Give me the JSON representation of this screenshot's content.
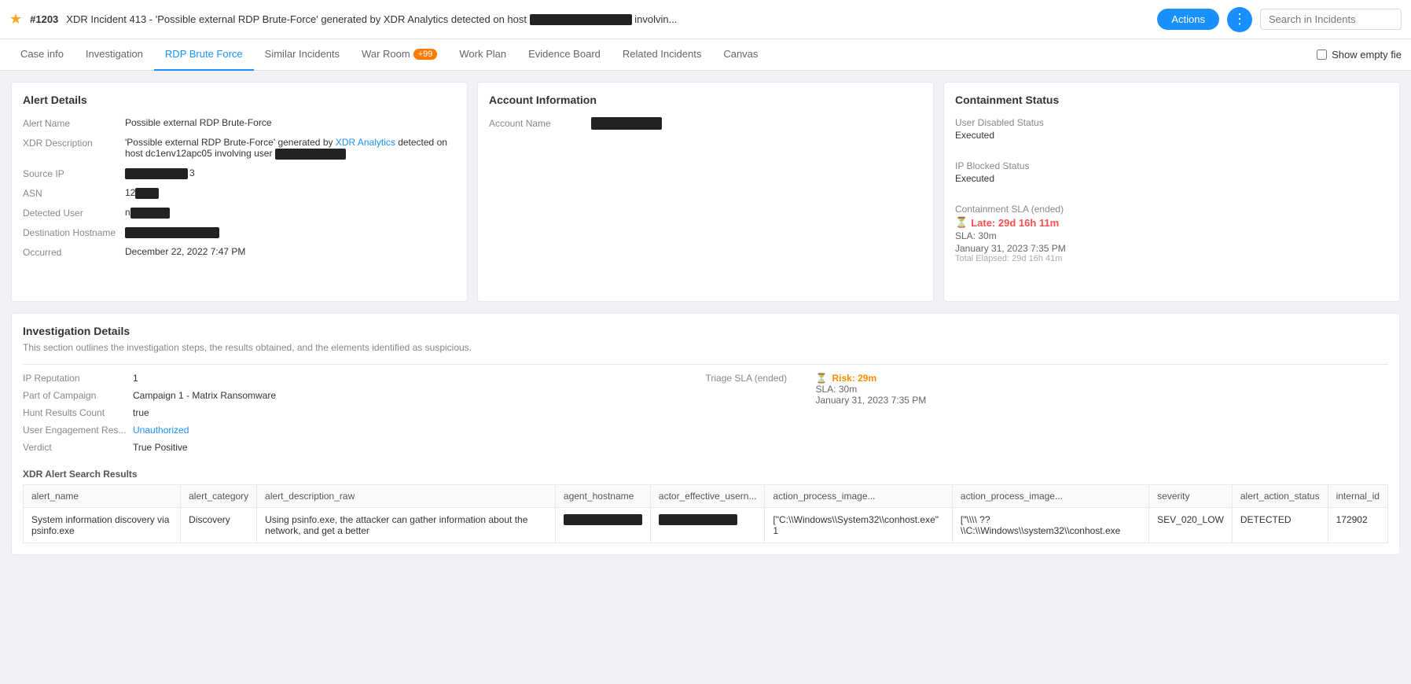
{
  "header": {
    "star": "★",
    "id": "#1203",
    "title": " XDR Incident 413 - 'Possible external RDP Brute-Force' generated by XDR Analytics detected on host ",
    "title_redacted": true,
    "title_suffix": " involvin...",
    "actions_label": "Actions",
    "more_icon": "⋮",
    "search_placeholder": "Search in Incidents"
  },
  "tabs": {
    "items": [
      {
        "id": "case-info",
        "label": "Case info",
        "active": false
      },
      {
        "id": "investigation",
        "label": "Investigation",
        "active": false
      },
      {
        "id": "rdp-brute-force",
        "label": "RDP Brute Force",
        "active": true
      },
      {
        "id": "similar-incidents",
        "label": "Similar Incidents",
        "active": false
      },
      {
        "id": "war-room",
        "label": "War Room",
        "active": false,
        "badge": "+99"
      },
      {
        "id": "work-plan",
        "label": "Work Plan",
        "active": false
      },
      {
        "id": "evidence-board",
        "label": "Evidence Board",
        "active": false
      },
      {
        "id": "related-incidents",
        "label": "Related Incidents",
        "active": false
      },
      {
        "id": "canvas",
        "label": "Canvas",
        "active": false
      }
    ],
    "show_empty_label": "Show empty fie"
  },
  "alert_details": {
    "title": "Alert Details",
    "fields": [
      {
        "label": "Alert Name",
        "value": "Possible external RDP Brute-Force",
        "redacted": false
      },
      {
        "label": "XDR Description",
        "value": "'Possible external RDP Brute-Force' generated by XDR Analytics detected on host dc1env12apc05 involving user",
        "redacted_suffix": true
      },
      {
        "label": "Source IP",
        "value": "",
        "redacted": true,
        "suffix": "3"
      },
      {
        "label": "ASN",
        "value": "12",
        "redacted": true
      },
      {
        "label": "Detected User",
        "value": "n",
        "redacted": true
      },
      {
        "label": "Destination Hostname",
        "value": "",
        "redacted": true
      },
      {
        "label": "Occurred",
        "value": "December 22, 2022 7:47 PM",
        "redacted": false
      }
    ]
  },
  "account_info": {
    "title": "Account Information",
    "fields": [
      {
        "label": "Account Name",
        "value": "",
        "redacted": true
      }
    ]
  },
  "containment_status": {
    "title": "Containment Status",
    "user_disabled_label": "User Disabled Status",
    "user_disabled_value": "Executed",
    "ip_blocked_label": "IP Blocked Status",
    "ip_blocked_value": "Executed",
    "sla_label": "Containment SLA (ended)",
    "sla_late": "Late: 29d 16h 11m",
    "sla_detail": "SLA: 30m",
    "sla_date": "January 31, 2023 7:35 PM",
    "sla_elapsed": "Total Elapsed: 29d 16h 41m"
  },
  "investigation_details": {
    "title": "Investigation Details",
    "description": "This section outlines the investigation steps, the results obtained, and the elements identified as suspicious.",
    "left_fields": [
      {
        "label": "IP Reputation",
        "value": "1"
      },
      {
        "label": "Part of Campaign",
        "value": "Campaign 1 - Matrix Ransomware"
      },
      {
        "label": "Hunt Results Count",
        "value": "true"
      },
      {
        "label": "User Engagement Res...",
        "value": "Unauthorized",
        "highlight": "link"
      },
      {
        "label": "Verdict",
        "value": "True Positive"
      }
    ],
    "right_fields": [
      {
        "label": "Triage SLA (ended)",
        "value": "Risk: 29m",
        "type": "sla"
      },
      {
        "label": "",
        "value": "SLA: 30m"
      },
      {
        "label": "",
        "value": "January 31, 2023 7:35 PM"
      }
    ],
    "table_label": "XDR Alert Search Results",
    "table_columns": [
      "alert_name",
      "alert_category",
      "alert_description_raw",
      "agent_hostname",
      "actor_effective_usern...",
      "action_process_image...",
      "action_process_image...",
      "severity",
      "alert_action_status",
      "internal_id"
    ],
    "table_rows": [
      {
        "alert_name": "System information discovery via psinfo.exe",
        "alert_category": "Discovery",
        "alert_description_raw": "Using psinfo.exe, the attacker can gather information about the network, and get a better",
        "agent_hostname": "",
        "actor_effective_usern": "",
        "action_process_image_1": "[\"C:\\\\Windows\\\\System32\\\\conhost.exe\" 1",
        "action_process_image_2": "[\"\\\\\\\\ ??\\\\C:\\\\Windows\\\\system32\\\\conhost.exe",
        "severity": "SEV_020_LOW",
        "alert_action_status": "DETECTED",
        "internal_id": "172902"
      }
    ]
  }
}
